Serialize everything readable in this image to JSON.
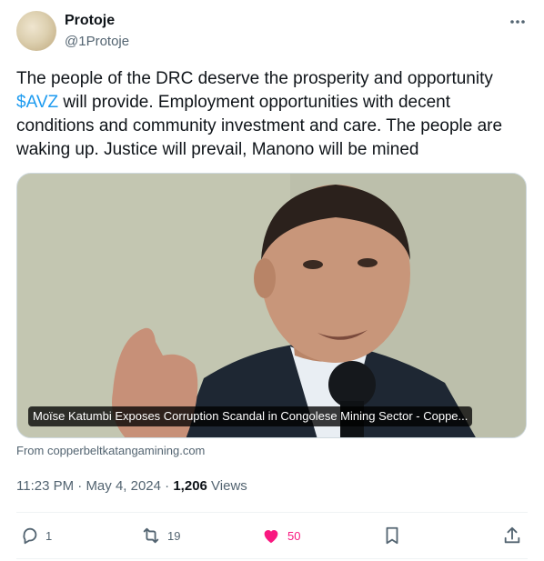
{
  "author": {
    "display_name": "Protoje",
    "handle": "@1Protoje"
  },
  "tweet": {
    "text_before": "The people of the DRC deserve the prosperity and opportunity ",
    "cashtag": "$AVZ",
    "text_after": " will provide. Employment opportunities with decent conditions and community investment and care. The people are waking up. Justice will prevail, Manono will be mined"
  },
  "card": {
    "caption": "Moïse Katumbi Exposes Corruption Scandal in Congolese Mining Sector - Coppe...",
    "source": "From copperbeltkatangamining.com"
  },
  "meta": {
    "time": "11:23 PM",
    "sep1": " · ",
    "date": "May 4, 2024",
    "sep2": " · ",
    "views_count": "1,206",
    "views_label": " Views"
  },
  "actions": {
    "replies": "1",
    "retweets": "19",
    "likes": "50"
  },
  "colors": {
    "accent": "#1d9bf0",
    "like": "#f91880",
    "secondary_text": "#536471"
  },
  "icons": [
    "more-icon",
    "reply-icon",
    "retweet-icon",
    "like-icon",
    "bookmark-icon",
    "share-icon"
  ]
}
